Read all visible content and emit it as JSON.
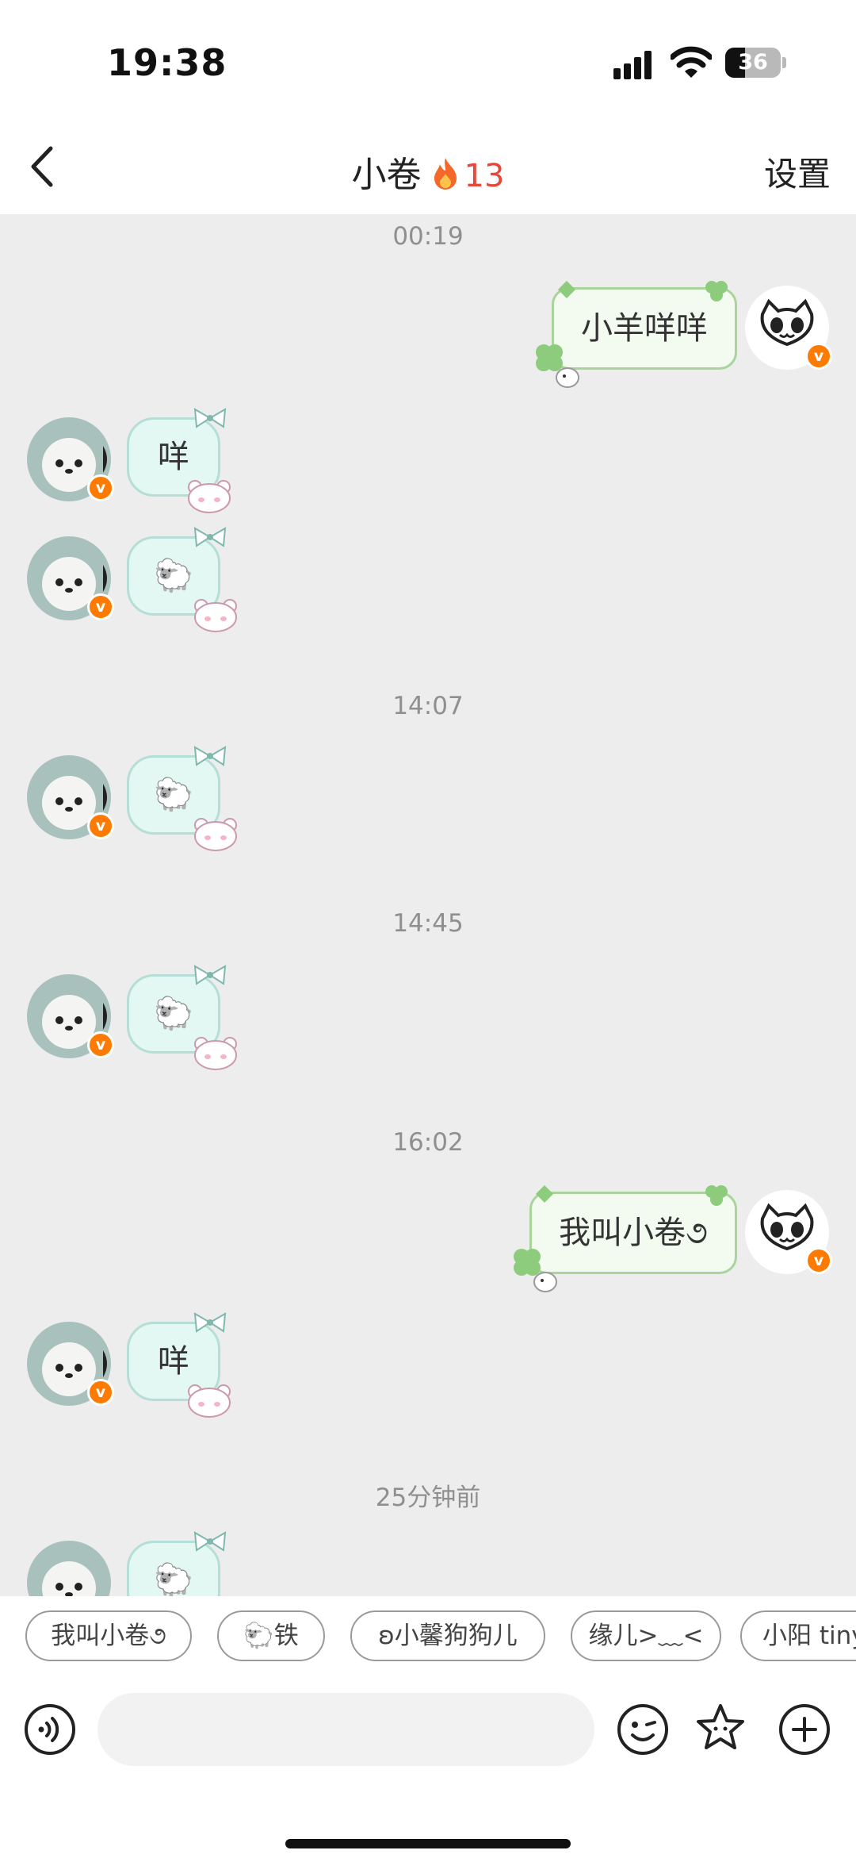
{
  "status_bar": {
    "time": "19:38",
    "battery": "36"
  },
  "nav": {
    "back_icon": "chevron-left-icon",
    "title": "小卷",
    "streak_icon": "fire-icon",
    "streak_count": "13",
    "settings_label": "设置"
  },
  "messages": [
    {
      "type": "timestamp",
      "text": "00:19"
    },
    {
      "type": "sent",
      "text": "小羊咩咩"
    },
    {
      "type": "received",
      "text": "咩"
    },
    {
      "type": "received",
      "text": "🐑"
    },
    {
      "type": "timestamp",
      "text": "14:07"
    },
    {
      "type": "received",
      "text": "🐑"
    },
    {
      "type": "timestamp",
      "text": "14:45"
    },
    {
      "type": "received",
      "text": "🐑"
    },
    {
      "type": "timestamp",
      "text": "16:02"
    },
    {
      "type": "sent",
      "text": "我叫小卷૭"
    },
    {
      "type": "received",
      "text": "咩"
    },
    {
      "type": "timestamp",
      "text": "25分钟前"
    },
    {
      "type": "received",
      "text": "🐑"
    }
  ],
  "badge_text": "v",
  "quick_replies": [
    "我叫小卷૭",
    "🐑铁",
    "ʚ小馨狗狗儿",
    "缘儿>﹏<",
    "小阳 tiny"
  ],
  "input": {
    "placeholder": "",
    "voice_icon": "voice-icon",
    "emoji_icon": "emoji-icon",
    "sticker_icon": "star-sticker-icon",
    "plus_icon": "plus-icon"
  },
  "colors": {
    "badge": "#ff7a00",
    "streak": "#e5483a",
    "received_bubble": "#e3f7f3",
    "sent_bubble": "#f3fbf0",
    "background": "#ededed"
  }
}
